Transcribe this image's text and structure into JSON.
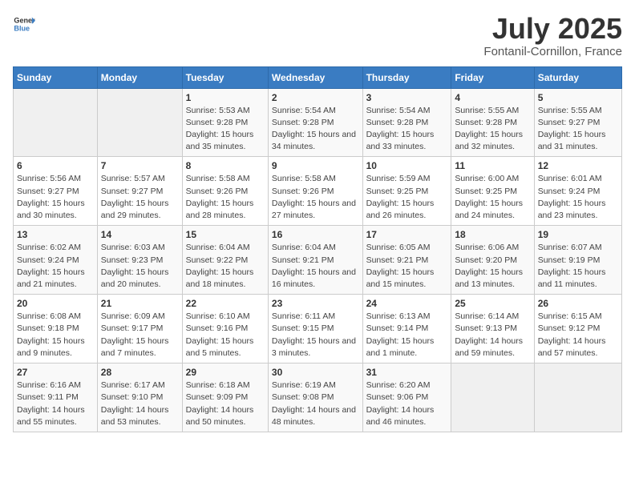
{
  "header": {
    "logo_general": "General",
    "logo_blue": "Blue",
    "title": "July 2025",
    "subtitle": "Fontanil-Cornillon, France"
  },
  "calendar": {
    "days_of_week": [
      "Sunday",
      "Monday",
      "Tuesday",
      "Wednesday",
      "Thursday",
      "Friday",
      "Saturday"
    ],
    "weeks": [
      [
        {
          "day": "",
          "sunrise": "",
          "sunset": "",
          "daylight": "",
          "empty": true
        },
        {
          "day": "",
          "sunrise": "",
          "sunset": "",
          "daylight": "",
          "empty": true
        },
        {
          "day": "1",
          "sunrise": "Sunrise: 5:53 AM",
          "sunset": "Sunset: 9:28 PM",
          "daylight": "Daylight: 15 hours and 35 minutes."
        },
        {
          "day": "2",
          "sunrise": "Sunrise: 5:54 AM",
          "sunset": "Sunset: 9:28 PM",
          "daylight": "Daylight: 15 hours and 34 minutes."
        },
        {
          "day": "3",
          "sunrise": "Sunrise: 5:54 AM",
          "sunset": "Sunset: 9:28 PM",
          "daylight": "Daylight: 15 hours and 33 minutes."
        },
        {
          "day": "4",
          "sunrise": "Sunrise: 5:55 AM",
          "sunset": "Sunset: 9:28 PM",
          "daylight": "Daylight: 15 hours and 32 minutes."
        },
        {
          "day": "5",
          "sunrise": "Sunrise: 5:55 AM",
          "sunset": "Sunset: 9:27 PM",
          "daylight": "Daylight: 15 hours and 31 minutes."
        }
      ],
      [
        {
          "day": "6",
          "sunrise": "Sunrise: 5:56 AM",
          "sunset": "Sunset: 9:27 PM",
          "daylight": "Daylight: 15 hours and 30 minutes."
        },
        {
          "day": "7",
          "sunrise": "Sunrise: 5:57 AM",
          "sunset": "Sunset: 9:27 PM",
          "daylight": "Daylight: 15 hours and 29 minutes."
        },
        {
          "day": "8",
          "sunrise": "Sunrise: 5:58 AM",
          "sunset": "Sunset: 9:26 PM",
          "daylight": "Daylight: 15 hours and 28 minutes."
        },
        {
          "day": "9",
          "sunrise": "Sunrise: 5:58 AM",
          "sunset": "Sunset: 9:26 PM",
          "daylight": "Daylight: 15 hours and 27 minutes."
        },
        {
          "day": "10",
          "sunrise": "Sunrise: 5:59 AM",
          "sunset": "Sunset: 9:25 PM",
          "daylight": "Daylight: 15 hours and 26 minutes."
        },
        {
          "day": "11",
          "sunrise": "Sunrise: 6:00 AM",
          "sunset": "Sunset: 9:25 PM",
          "daylight": "Daylight: 15 hours and 24 minutes."
        },
        {
          "day": "12",
          "sunrise": "Sunrise: 6:01 AM",
          "sunset": "Sunset: 9:24 PM",
          "daylight": "Daylight: 15 hours and 23 minutes."
        }
      ],
      [
        {
          "day": "13",
          "sunrise": "Sunrise: 6:02 AM",
          "sunset": "Sunset: 9:24 PM",
          "daylight": "Daylight: 15 hours and 21 minutes."
        },
        {
          "day": "14",
          "sunrise": "Sunrise: 6:03 AM",
          "sunset": "Sunset: 9:23 PM",
          "daylight": "Daylight: 15 hours and 20 minutes."
        },
        {
          "day": "15",
          "sunrise": "Sunrise: 6:04 AM",
          "sunset": "Sunset: 9:22 PM",
          "daylight": "Daylight: 15 hours and 18 minutes."
        },
        {
          "day": "16",
          "sunrise": "Sunrise: 6:04 AM",
          "sunset": "Sunset: 9:21 PM",
          "daylight": "Daylight: 15 hours and 16 minutes."
        },
        {
          "day": "17",
          "sunrise": "Sunrise: 6:05 AM",
          "sunset": "Sunset: 9:21 PM",
          "daylight": "Daylight: 15 hours and 15 minutes."
        },
        {
          "day": "18",
          "sunrise": "Sunrise: 6:06 AM",
          "sunset": "Sunset: 9:20 PM",
          "daylight": "Daylight: 15 hours and 13 minutes."
        },
        {
          "day": "19",
          "sunrise": "Sunrise: 6:07 AM",
          "sunset": "Sunset: 9:19 PM",
          "daylight": "Daylight: 15 hours and 11 minutes."
        }
      ],
      [
        {
          "day": "20",
          "sunrise": "Sunrise: 6:08 AM",
          "sunset": "Sunset: 9:18 PM",
          "daylight": "Daylight: 15 hours and 9 minutes."
        },
        {
          "day": "21",
          "sunrise": "Sunrise: 6:09 AM",
          "sunset": "Sunset: 9:17 PM",
          "daylight": "Daylight: 15 hours and 7 minutes."
        },
        {
          "day": "22",
          "sunrise": "Sunrise: 6:10 AM",
          "sunset": "Sunset: 9:16 PM",
          "daylight": "Daylight: 15 hours and 5 minutes."
        },
        {
          "day": "23",
          "sunrise": "Sunrise: 6:11 AM",
          "sunset": "Sunset: 9:15 PM",
          "daylight": "Daylight: 15 hours and 3 minutes."
        },
        {
          "day": "24",
          "sunrise": "Sunrise: 6:13 AM",
          "sunset": "Sunset: 9:14 PM",
          "daylight": "Daylight: 15 hours and 1 minute."
        },
        {
          "day": "25",
          "sunrise": "Sunrise: 6:14 AM",
          "sunset": "Sunset: 9:13 PM",
          "daylight": "Daylight: 14 hours and 59 minutes."
        },
        {
          "day": "26",
          "sunrise": "Sunrise: 6:15 AM",
          "sunset": "Sunset: 9:12 PM",
          "daylight": "Daylight: 14 hours and 57 minutes."
        }
      ],
      [
        {
          "day": "27",
          "sunrise": "Sunrise: 6:16 AM",
          "sunset": "Sunset: 9:11 PM",
          "daylight": "Daylight: 14 hours and 55 minutes."
        },
        {
          "day": "28",
          "sunrise": "Sunrise: 6:17 AM",
          "sunset": "Sunset: 9:10 PM",
          "daylight": "Daylight: 14 hours and 53 minutes."
        },
        {
          "day": "29",
          "sunrise": "Sunrise: 6:18 AM",
          "sunset": "Sunset: 9:09 PM",
          "daylight": "Daylight: 14 hours and 50 minutes."
        },
        {
          "day": "30",
          "sunrise": "Sunrise: 6:19 AM",
          "sunset": "Sunset: 9:08 PM",
          "daylight": "Daylight: 14 hours and 48 minutes."
        },
        {
          "day": "31",
          "sunrise": "Sunrise: 6:20 AM",
          "sunset": "Sunset: 9:06 PM",
          "daylight": "Daylight: 14 hours and 46 minutes."
        },
        {
          "day": "",
          "sunrise": "",
          "sunset": "",
          "daylight": "",
          "empty": true
        },
        {
          "day": "",
          "sunrise": "",
          "sunset": "",
          "daylight": "",
          "empty": true
        }
      ]
    ]
  }
}
